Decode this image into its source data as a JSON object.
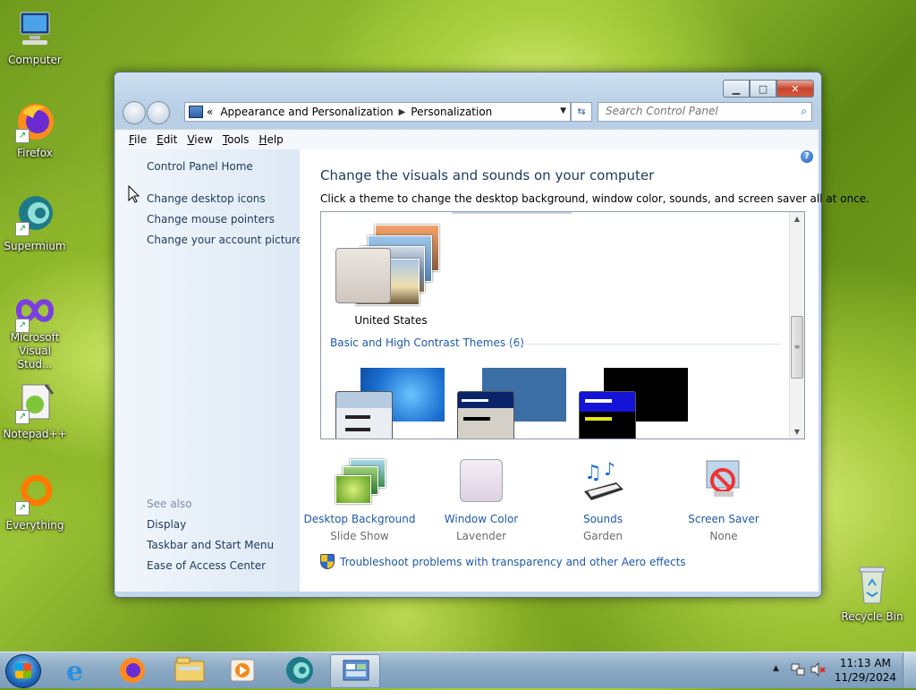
{
  "desktop": {
    "icons": [
      {
        "label": "Computer"
      },
      {
        "label": "Firefox"
      },
      {
        "label": "Supermium"
      },
      {
        "label": "Microsoft Visual Stud..."
      },
      {
        "label": "Notepad++"
      },
      {
        "label": "Everything"
      },
      {
        "label": "Recycle Bin"
      }
    ]
  },
  "window": {
    "breadcrumb": [
      "Appearance and Personalization",
      "Personalization"
    ],
    "breadcrumb_prefix": "«",
    "search_placeholder": "Search Control Panel",
    "menu": [
      "File",
      "Edit",
      "View",
      "Tools",
      "Help"
    ],
    "left_pane": {
      "home": "Control Panel Home",
      "links": [
        "Change desktop icons",
        "Change mouse pointers",
        "Change your account picture"
      ],
      "see_also_heading": "See also",
      "see_also": [
        "Display",
        "Taskbar and Start Menu",
        "Ease of Access Center"
      ]
    },
    "main": {
      "title": "Change the visuals and sounds on your computer",
      "description": "Click a theme to change the desktop background, window color, sounds, and screen saver all at once.",
      "current_theme_label": "United States",
      "basic_group_heading": "Basic and High Contrast Themes (6)",
      "properties": [
        {
          "name": "Desktop Background",
          "value": "Slide Show",
          "icon": "desktop-background-icon"
        },
        {
          "name": "Window Color",
          "value": "Lavender",
          "icon": "window-color-icon"
        },
        {
          "name": "Sounds",
          "value": "Garden",
          "icon": "sounds-icon"
        },
        {
          "name": "Screen Saver",
          "value": "None",
          "icon": "screen-saver-icon"
        }
      ],
      "troubleshoot": "Troubleshoot problems with transparency and other Aero effects"
    }
  },
  "taskbar": {
    "time": "11:13 AM",
    "date": "11/29/2024"
  },
  "colors": {
    "link_blue": "#1e5aa8",
    "heading_blue": "#1e395b",
    "taskbar": "#8aa9c4"
  }
}
